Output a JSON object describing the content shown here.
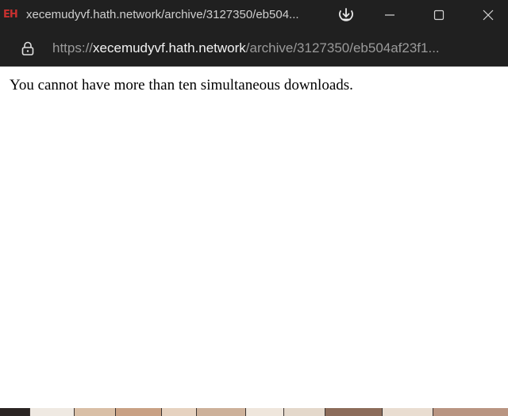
{
  "window": {
    "title": "xecemudyvf.hath.network/archive/3127350/eb504...",
    "favicon_text": "EH"
  },
  "address_bar": {
    "scheme": "https://",
    "host": "xecemudyvf.hath.network",
    "path": "/archive/3127350/eb504af23f1..."
  },
  "page": {
    "message": "You cannot have more than ten simultaneous downloads."
  },
  "icons": {
    "download": "download-icon",
    "minimize": "minimize-icon",
    "maximize": "maximize-icon",
    "close": "close-icon",
    "lock": "lock-icon"
  },
  "colors": {
    "titlebar_bg": "#202020",
    "favicon": "#c8302f",
    "host_text": "#f2f2f2",
    "path_text": "#9a9a9a",
    "page_bg": "#ffffff"
  }
}
